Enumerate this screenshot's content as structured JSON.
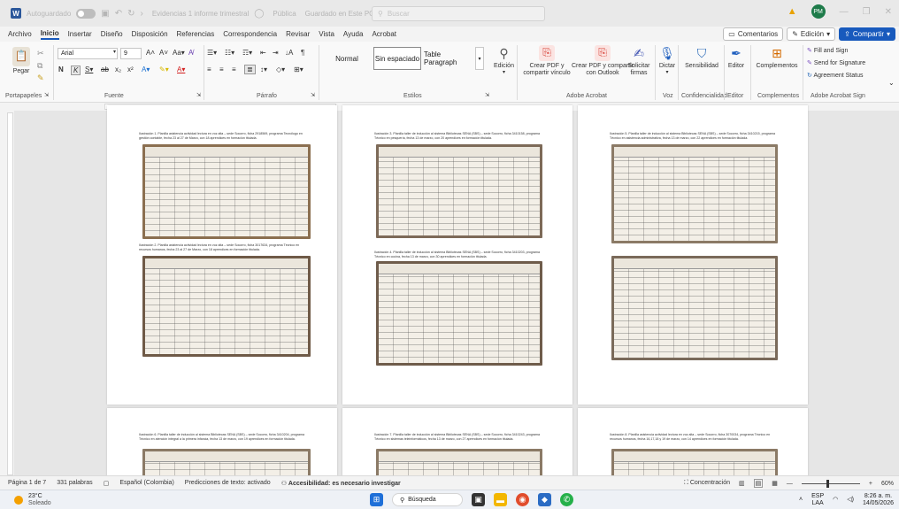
{
  "title_bar": {
    "autosave_label": "Autoguardado",
    "document_title": "Evidencias 1 informe trimestral",
    "sensitivity": "Pública",
    "save_status": "Guardado en Este PC",
    "search_placeholder": "Buscar",
    "user_initials": "PM"
  },
  "menu": {
    "items": [
      "Archivo",
      "Inicio",
      "Insertar",
      "Diseño",
      "Disposición",
      "Referencias",
      "Correspondencia",
      "Revisar",
      "Vista",
      "Ayuda",
      "Acrobat"
    ],
    "active": "Inicio",
    "comments": "Comentarios",
    "editing": "Edición",
    "share": "Compartir"
  },
  "ribbon": {
    "clipboard": {
      "paste": "Pegar",
      "label": "Portapapeles"
    },
    "font": {
      "name": "Arial",
      "size": "9",
      "label": "Fuente"
    },
    "paragraph": {
      "label": "Párrafo"
    },
    "styles": {
      "items": [
        "Normal",
        "Sin espaciado",
        "Table Paragraph"
      ],
      "selected": "Sin espaciado",
      "label": "Estilos"
    },
    "editing": {
      "label": "Edición"
    },
    "acrobat": {
      "create_share_1": "Crear PDF y",
      "create_share_2": "compartir vínculo",
      "outlook_1": "Crear PDF y compartir",
      "outlook_2": "con Outlook",
      "request_1": "Solicitar",
      "request_2": "firmas",
      "label": "Adobe Acrobat"
    },
    "voice": {
      "dictate": "Dictar",
      "label": "Voz"
    },
    "sensitivity": {
      "button": "Sensibilidad",
      "label": "Confidencialidad"
    },
    "editor": {
      "button": "Editor",
      "label": "Editor"
    },
    "addins": {
      "button": "Complementos",
      "label": "Complementos"
    },
    "sign": {
      "fill": "Fill and Sign",
      "send": "Send for Signature",
      "status": "Agreement Status",
      "label": "Adobe Acrobat Sign"
    }
  },
  "pages": [
    {
      "caption1": "Ilustración 1. Planilla asistencia actividad lectura en voz alta – sede Socorro, ficha 2918569, programa Tecnólogo en gestión contable, fecha 23 al 27 de Marzo, con 18 aprendices en formación titulada.",
      "caption2": "Ilustración 2. Planilla asistencia actividad lectura en voz alta – sede Socorro, ficha 3017634, programa Técnico en recursos humanos, fecha 23 al 27 de Marzo, con 18 aprendices en formación titulada."
    },
    {
      "caption1": "Ilustración 3. Planilla taller de inducción al sistema Bibliotecas SENA (SBS) – sede Socorro, ficha 3410158, programa Técnico en pesquería, fecha 13 de marzo, con 20 aprendices en formación titulada.",
      "caption2": "Ilustración 4. Planilla taller de inducción al sistema Bibliotecas SENA (SBS) – sede Socorro, ficha 3410203, programa Técnico en cocina, fecha 13 de marzo, con 30 aprendices en formación titulada."
    },
    {
      "caption1": "Ilustración 5. Planilla taller de inducción al sistema Bibliotecas SENA (SBS) – sede Socorro, ficha 3410215, programa Técnico en asistencia administrativa, fecha 13 de marzo, con 22 aprendices en formación titulada.",
      "caption2": ""
    },
    {
      "caption1": "Ilustración 6. Planilla taller de inducción al sistema Bibliotecas SENA (SBS) – sede Socorro, ficha 3410204, programa Técnico en atención integral a la primera infancia, fecha 13 de marzo, con 19 aprendices en formación titulada.",
      "caption2": ""
    },
    {
      "caption1": "Ilustración 7. Planilla taller de inducción al sistema Bibliotecas SENA (SBS) – sede Socorro, ficha 3410243, programa Técnico en sistemas teleinformáticos, fecha 13 de marzo, con 27 aprendices en formación titulada.",
      "caption2": ""
    },
    {
      "caption1": "Ilustración 8. Planilla asistencia actividad lectura en voz alta – sede Socorro, ficha 3070034, programa Técnico en recursos humanos, fecha 16,17,18 y 19 de marzo, con 14 aprendices en formación titulada.",
      "caption2": ""
    }
  ],
  "status_bar": {
    "page": "Página 1 de 7",
    "words": "331 palabras",
    "language": "Español (Colombia)",
    "predictions": "Predicciones de texto: activado",
    "accessibility": "Accesibilidad: es necesario investigar",
    "focus": "Concentración",
    "zoom": "60%"
  },
  "taskbar": {
    "temp": "23°C",
    "weather": "Soleado",
    "search": "Búsqueda",
    "lang_1": "ESP",
    "lang_2": "LAA",
    "time": "8:26 a. m.",
    "date": "14/05/2026"
  }
}
